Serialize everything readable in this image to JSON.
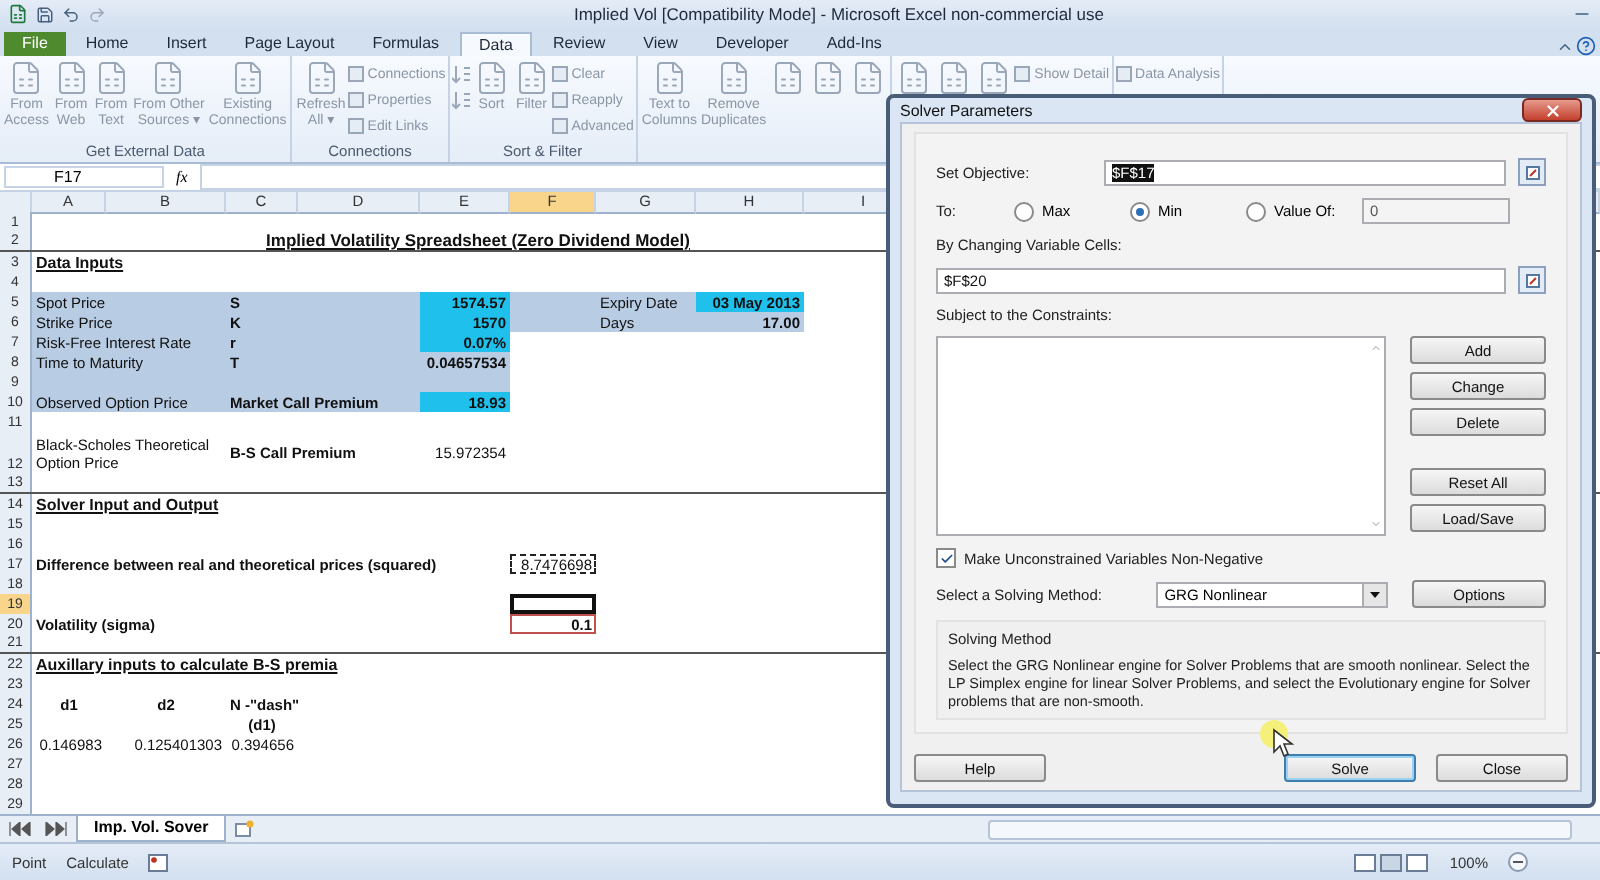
{
  "window": {
    "title": "Implied Vol  [Compatibility Mode] - Microsoft Excel non-commercial use"
  },
  "ribbon_tabs": [
    {
      "label": "File",
      "kind": "file",
      "selected": false
    },
    {
      "label": "Home",
      "kind": "tab",
      "selected": false
    },
    {
      "label": "Insert",
      "kind": "tab",
      "selected": false
    },
    {
      "label": "Page Layout",
      "kind": "tab",
      "selected": false
    },
    {
      "label": "Formulas",
      "kind": "tab",
      "selected": false
    },
    {
      "label": "Data",
      "kind": "tab",
      "selected": true
    },
    {
      "label": "Review",
      "kind": "tab",
      "selected": false
    },
    {
      "label": "View",
      "kind": "tab",
      "selected": false
    },
    {
      "label": "Developer",
      "kind": "tab",
      "selected": false
    },
    {
      "label": "Add-Ins",
      "kind": "tab",
      "selected": false
    }
  ],
  "ribbon_groups": [
    {
      "label": "Get External Data",
      "items": [
        {
          "kind": "large",
          "label": "From\nAccess"
        },
        {
          "kind": "large",
          "label": "From\nWeb"
        },
        {
          "kind": "large",
          "label": "From\nText"
        },
        {
          "kind": "large",
          "label": "From Other\nSources ▾"
        },
        {
          "kind": "large",
          "label": "Existing\nConnections"
        }
      ]
    },
    {
      "label": "Connections",
      "items": [
        {
          "kind": "large",
          "label": "Refresh\nAll ▾"
        },
        {
          "kind": "stack",
          "items": [
            {
              "label": "Connections"
            },
            {
              "label": "Properties"
            },
            {
              "label": "Edit Links"
            }
          ]
        }
      ]
    },
    {
      "label": "Sort & Filter",
      "items": [
        {
          "kind": "sort"
        },
        {
          "kind": "large",
          "label": "Sort"
        },
        {
          "kind": "large",
          "label": "Filter"
        },
        {
          "kind": "stack",
          "items": [
            {
              "label": "Clear"
            },
            {
              "label": "Reapply"
            },
            {
              "label": "Advanced"
            }
          ]
        }
      ]
    },
    {
      "items": [
        {
          "kind": "large",
          "label": "Text to\nColumns"
        },
        {
          "kind": "large",
          "label": "Remove\nDuplicates"
        },
        {
          "kind": "icon"
        },
        {
          "kind": "icon"
        },
        {
          "kind": "icon"
        }
      ]
    },
    {
      "items": [
        {
          "kind": "icon"
        },
        {
          "kind": "icon"
        },
        {
          "kind": "icon"
        },
        {
          "kind": "stack",
          "items": [
            {
              "label": "Show Detail"
            }
          ]
        }
      ]
    },
    {
      "items": [
        {
          "kind": "stack",
          "items": [
            {
              "label": "Data Analysis"
            }
          ]
        }
      ]
    }
  ],
  "formula_bar": {
    "name_box": "F17",
    "function_label": "fx"
  },
  "columns": [
    {
      "label": "A",
      "selected": false
    },
    {
      "label": "B",
      "selected": false
    },
    {
      "label": "C",
      "selected": false
    },
    {
      "label": "D",
      "selected": false
    },
    {
      "label": "E",
      "selected": false
    },
    {
      "label": "F",
      "selected": true
    },
    {
      "label": "G",
      "selected": false
    },
    {
      "label": "H",
      "selected": false
    },
    {
      "label": "I",
      "selected": false
    }
  ],
  "rows": [
    {
      "number": "1",
      "selected": false,
      "cells": {}
    },
    {
      "number": "2",
      "selected": false,
      "rule": true,
      "cells": {
        "a": {
          "kind": "title",
          "wide": true,
          "text": "Implied Volatility Spreadsheet (Zero Dividend Model)"
        }
      }
    },
    {
      "number": "3",
      "selected": false,
      "cells": {
        "a": {
          "kind": "heading",
          "wide": true,
          "text": "Data Inputs"
        }
      }
    },
    {
      "number": "4",
      "selected": false,
      "cells": {}
    },
    {
      "number": "5",
      "selected": false,
      "cells": {
        "a": {
          "kind": "label",
          "shaded": true,
          "wide": true,
          "text": "Spot Price"
        },
        "c": {
          "kind": "key",
          "shaded": true,
          "wide": true,
          "text": "S"
        },
        "e": {
          "kind": "value",
          "highlighted": true,
          "text": "1574.57"
        },
        "f": {
          "shaded": true
        },
        "g": {
          "kind": "label",
          "shaded": true,
          "text": "Expiry Date"
        },
        "h": {
          "kind": "value",
          "highlighted": true,
          "text": "03 May 2013"
        }
      }
    },
    {
      "number": "6",
      "selected": false,
      "cells": {
        "a": {
          "kind": "label",
          "shaded": true,
          "wide": true,
          "text": "Strike Price"
        },
        "c": {
          "kind": "key",
          "shaded": true,
          "wide": true,
          "text": "K"
        },
        "e": {
          "kind": "value",
          "highlighted": true,
          "text": "1570"
        },
        "f": {
          "shaded": true
        },
        "g": {
          "kind": "label",
          "shaded": true,
          "text": "Days"
        },
        "h": {
          "kind": "value",
          "shaded": true,
          "text": "17.00"
        }
      }
    },
    {
      "number": "7",
      "selected": false,
      "cells": {
        "a": {
          "kind": "label",
          "shaded": true,
          "wide": true,
          "text": "Risk-Free Interest Rate"
        },
        "c": {
          "kind": "key",
          "shaded": true,
          "wide": true,
          "text": "r"
        },
        "e": {
          "kind": "value",
          "highlighted": true,
          "text": "0.07%"
        }
      }
    },
    {
      "number": "8",
      "selected": false,
      "cells": {
        "a": {
          "kind": "label",
          "shaded": true,
          "wide": true,
          "text": "Time to Maturity"
        },
        "c": {
          "kind": "key",
          "shaded": true,
          "wide": true,
          "text": "T"
        },
        "e": {
          "kind": "value",
          "shaded": true,
          "text": "0.04657534"
        }
      }
    },
    {
      "number": "9",
      "selected": false,
      "cells": {
        "a": {
          "shaded": true,
          "wide": true
        },
        "e": {
          "shaded": true
        }
      }
    },
    {
      "number": "10",
      "selected": false,
      "cells": {
        "a": {
          "kind": "label",
          "shaded": true,
          "wide": true,
          "text": "Observed Option Price"
        },
        "c": {
          "kind": "key",
          "shaded": true,
          "wide": true,
          "text": "Market Call Premium"
        },
        "e": {
          "kind": "value",
          "highlighted": true,
          "text": "18.93"
        }
      }
    },
    {
      "number": "11",
      "selected": false,
      "cells": {}
    },
    {
      "number": "12",
      "selected": false,
      "tall": true,
      "cells": {
        "a": {
          "kind": "label",
          "wide": true,
          "text": "Black-Scholes Theoretical Option Price"
        },
        "c": {
          "kind": "key",
          "wide": true,
          "text": "B-S Call Premium"
        },
        "e": {
          "kind": "number",
          "text": "15.972354"
        }
      }
    },
    {
      "number": "13",
      "selected": false,
      "rule": true,
      "cells": {}
    },
    {
      "number": "14",
      "selected": false,
      "cells": {
        "a": {
          "kind": "heading",
          "wide": true,
          "text": "Solver Input and Output"
        }
      }
    },
    {
      "number": "15",
      "selected": false,
      "cells": {}
    },
    {
      "number": "16",
      "selected": false,
      "cells": {}
    },
    {
      "number": "17",
      "selected": false,
      "cells": {
        "a": {
          "kind": "key",
          "wide": true,
          "text": "Difference between real and theoretical prices (squared)"
        },
        "f": {
          "kind": "number",
          "copied": true,
          "text": "8.7476698"
        }
      }
    },
    {
      "number": "18",
      "selected": false,
      "cells": {}
    },
    {
      "number": "19",
      "selected": true,
      "cells": {
        "f": {
          "active": true
        }
      }
    },
    {
      "number": "20",
      "selected": false,
      "cells": {
        "a": {
          "kind": "key",
          "wide": true,
          "text": "Volatility (sigma)"
        },
        "f": {
          "kind": "value",
          "outlined": true,
          "text": "0.1"
        }
      }
    },
    {
      "number": "21",
      "selected": false,
      "rule": true,
      "cells": {}
    },
    {
      "number": "22",
      "selected": false,
      "cells": {
        "a": {
          "kind": "heading",
          "wide": true,
          "text": "Auxillary inputs to calculate B-S premia"
        }
      }
    },
    {
      "number": "23",
      "selected": false,
      "cells": {}
    },
    {
      "number": "24",
      "selected": false,
      "cells": {
        "a": {
          "kind": "center",
          "text": "d1"
        },
        "b": {
          "kind": "center",
          "text": "d2"
        },
        "c": {
          "kind": "key",
          "wide": true,
          "text": "N -\"dash\""
        }
      }
    },
    {
      "number": "25",
      "selected": false,
      "cells": {
        "c": {
          "kind": "center",
          "text": "(d1)"
        }
      }
    },
    {
      "number": "26",
      "selected": false,
      "cells": {
        "a": {
          "kind": "number",
          "text": "0.146983"
        },
        "b": {
          "kind": "number",
          "text": "0.125401303"
        },
        "c": {
          "kind": "number",
          "text": "0.394656"
        }
      }
    },
    {
      "number": "27",
      "selected": false,
      "cells": {}
    },
    {
      "number": "28",
      "selected": false,
      "cells": {}
    },
    {
      "number": "29",
      "selected": false,
      "cells": {}
    }
  ],
  "sheet_tabs": [
    {
      "label": "Imp. Vol. Sover",
      "selected": true
    }
  ],
  "status_bar": {
    "items": [
      "Point",
      "Calculate"
    ],
    "zoom": "100%"
  },
  "dialog": {
    "title": "Solver Parameters",
    "objective": {
      "label": "Set Objective:",
      "value": "$F$17"
    },
    "to": {
      "label": "To:",
      "options": [
        {
          "label": "Max",
          "selected": false
        },
        {
          "label": "Min",
          "selected": true
        },
        {
          "label": "Value Of:",
          "selected": false
        }
      ],
      "value": "0"
    },
    "changing": {
      "label": "By Changing Variable Cells:",
      "value": "$F$20"
    },
    "constraints": {
      "label": "Subject to the Constraints:"
    },
    "side_buttons": [
      {
        "label": "Add",
        "kind": "button"
      },
      {
        "label": "Change",
        "kind": "button"
      },
      {
        "label": "Delete",
        "kind": "button"
      },
      {
        "kind": "gap"
      },
      {
        "label": "Reset All",
        "kind": "button"
      },
      {
        "label": "Load/Save",
        "kind": "button"
      }
    ],
    "nonnegative": {
      "label": "Make Unconstrained Variables Non-Negative",
      "checked": true
    },
    "method": {
      "label": "Select a Solving Method:",
      "value": "GRG Nonlinear",
      "button": "Options"
    },
    "method_group": {
      "title": "Solving Method",
      "description": "Select the GRG Nonlinear engine for Solver Problems that are smooth nonlinear. Select the LP Simplex engine for linear Solver Problems, and select the Evolutionary engine for Solver problems that are non-smooth."
    },
    "footer": [
      {
        "label": "Help",
        "default": false
      },
      {
        "label": "Solve",
        "default": true
      },
      {
        "label": "Close",
        "default": false
      }
    ]
  }
}
